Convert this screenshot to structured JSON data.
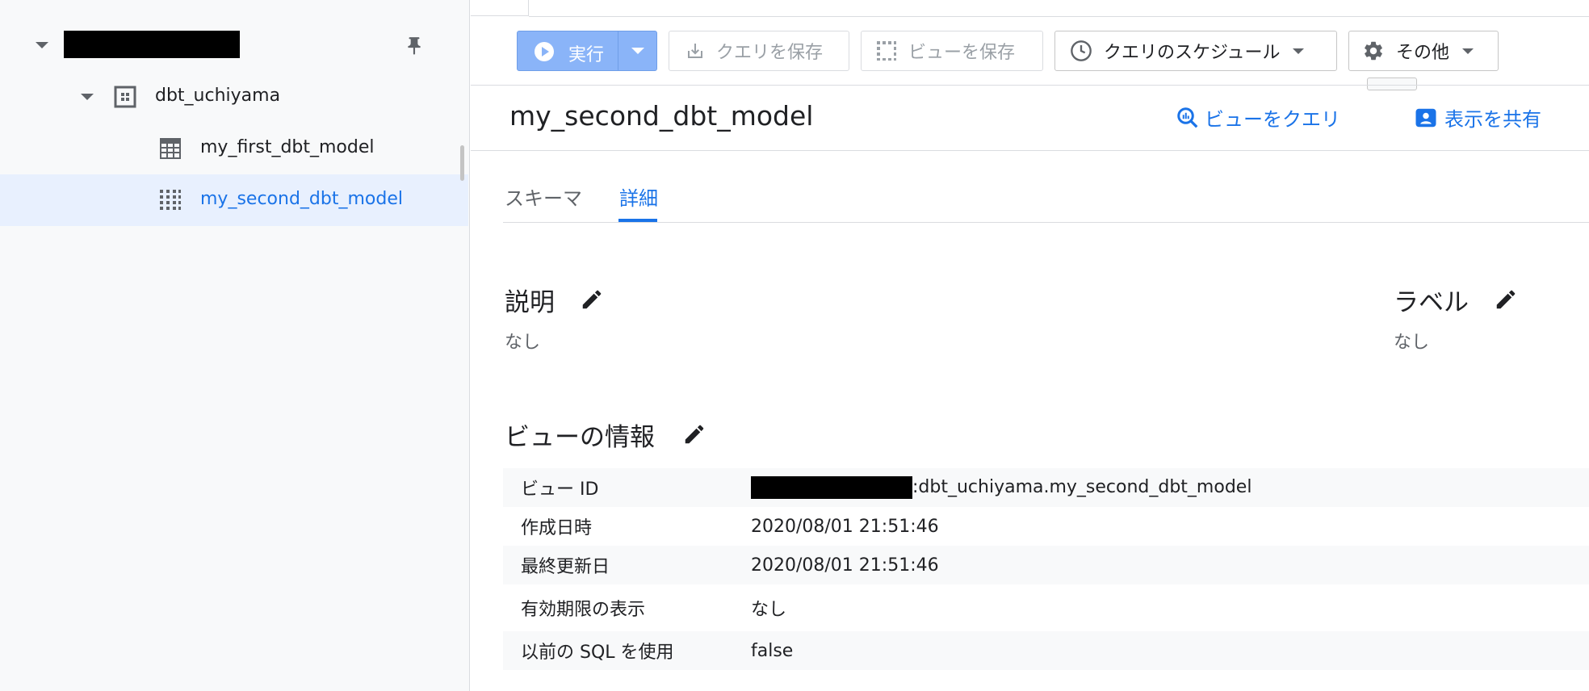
{
  "sidebar": {
    "project_label": "",
    "dataset": {
      "label": "dbt_uchiyama"
    },
    "items": [
      {
        "label": "my_first_dbt_model",
        "icon": "table-icon"
      },
      {
        "label": "my_second_dbt_model",
        "icon": "view-icon"
      }
    ]
  },
  "toolbar": {
    "run_label": "実行",
    "save_query_label": "クエリを保存",
    "save_view_label": "ビューを保存",
    "schedule_label": "クエリのスケジュール",
    "more_label": "その他"
  },
  "header": {
    "title": "my_second_dbt_model",
    "query_view_label": "ビューをクエリ",
    "share_label": "表示を共有"
  },
  "tabs": [
    {
      "label": "スキーマ"
    },
    {
      "label": "詳細"
    }
  ],
  "details": {
    "description": {
      "heading": "説明",
      "value": "なし"
    },
    "labels": {
      "heading": "ラベル",
      "value": "なし"
    },
    "view_info": {
      "heading": "ビューの情報",
      "rows": [
        {
          "key": "ビュー ID",
          "value": ":dbt_uchiyama.my_second_dbt_model"
        },
        {
          "key": "作成日時",
          "value": "2020/08/01 21:51:46"
        },
        {
          "key": "最終更新日",
          "value": "2020/08/01 21:51:46"
        },
        {
          "key": "有効期限の表示",
          "value": "なし"
        },
        {
          "key": "以前の SQL を使用",
          "value": "false"
        }
      ]
    }
  },
  "colors": {
    "accent": "#1a73e8",
    "run_button": "#8ab4f8",
    "selected_row": "#e8f0fe"
  }
}
